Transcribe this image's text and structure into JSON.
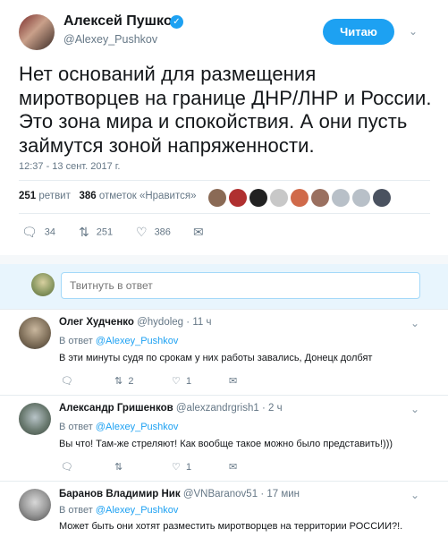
{
  "tweet": {
    "author_name": "Алексей Пушков",
    "author_handle": "@Alexey_Pushkov",
    "follow_label": "Читаю",
    "text": "Нет оснований для размещения миротворцев на границе ДНР/ЛНР и России. Это зона мира и спокойствия. А они пусть займутся зоной напряженности.",
    "timestamp": "12:37 - 13 сент. 2017 г.",
    "retweet_count": "251",
    "retweet_label": "ретвит",
    "like_count": "386",
    "like_label": "отметок «Нравится»",
    "actions": {
      "reply_count": "34",
      "retweet_count": "251",
      "like_count": "386"
    },
    "liker_colors": [
      "#8a6a55",
      "#b03030",
      "#222222",
      "#c8c8c8",
      "#d06a4a",
      "#9a7060",
      "#b8c0c8",
      "#b8c0c8",
      "#4a5260",
      "#555b60"
    ]
  },
  "reply_box": {
    "placeholder": "Твитнуть в ответ"
  },
  "replies": [
    {
      "name": "Олег Худченко",
      "handle": "@hydoleg",
      "time": "11 ч",
      "reply_to_prefix": "В ответ",
      "reply_to_handle": "@Alexey_Pushkov",
      "text": "В эти минуты судя по срокам у них работы завались, Донецк долбят",
      "reply_count": "",
      "retweet_count": "2",
      "like_count": "1"
    },
    {
      "name": "Александр Гришенков",
      "handle": "@alexzandrgrish1",
      "time": "2 ч",
      "reply_to_prefix": "В ответ",
      "reply_to_handle": "@Alexey_Pushkov",
      "text": "Вы что! Там-же стреляют! Как вообще такое можно было представить!)))",
      "reply_count": "",
      "retweet_count": "",
      "like_count": "1"
    },
    {
      "name": "Баранов Владимир Ник",
      "handle": "@VNBaranov51",
      "time": "17 мин",
      "reply_to_prefix": "В ответ",
      "reply_to_handle": "@Alexey_Pushkov",
      "text": "Может быть они хотят разместить миротворцев на территории РОССИИ?!.",
      "reply_count": "",
      "retweet_count": "",
      "like_count": ""
    }
  ]
}
